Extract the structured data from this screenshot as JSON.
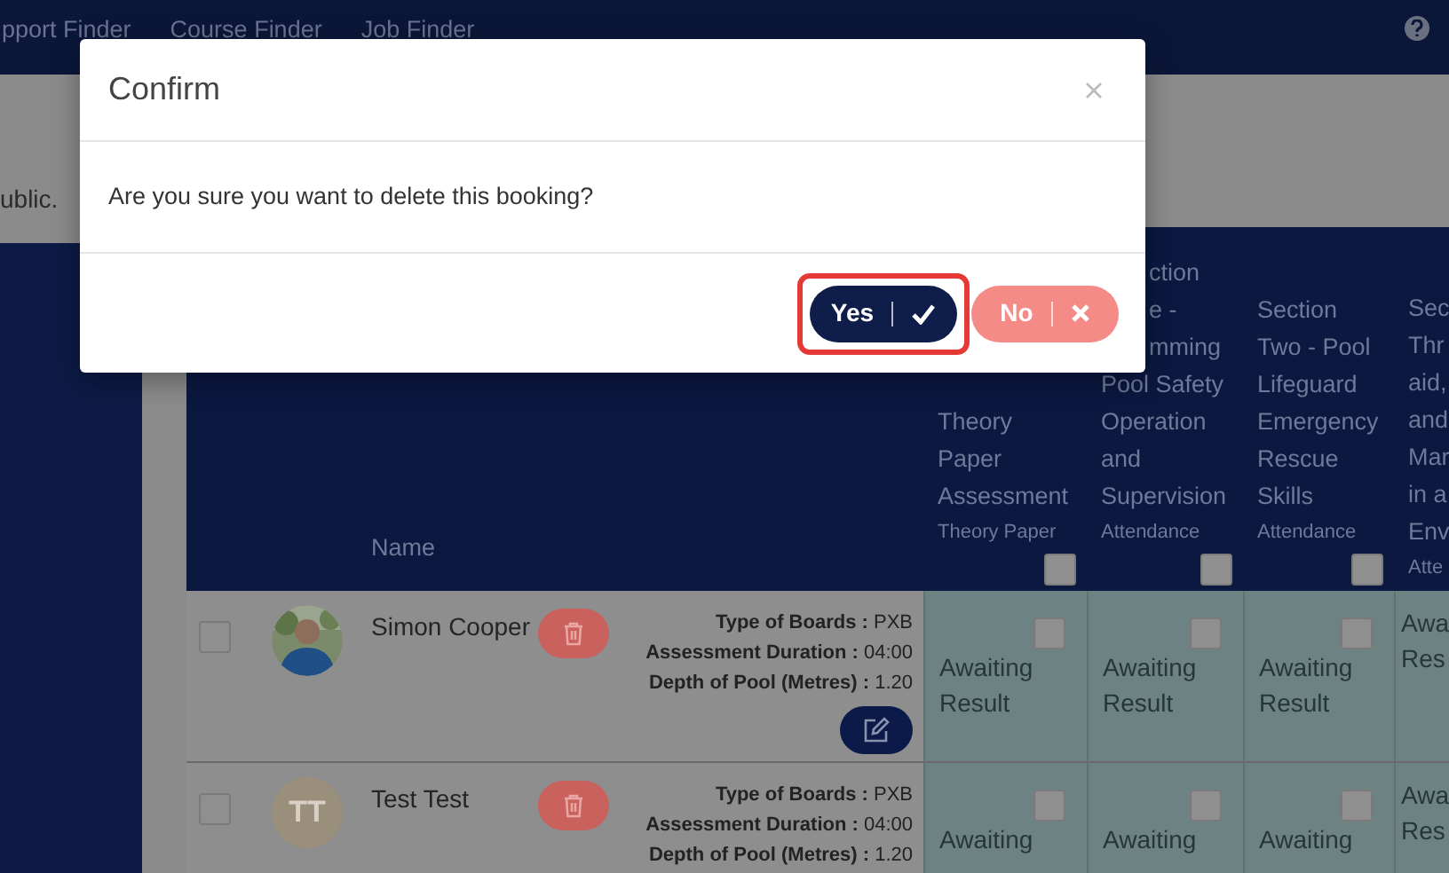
{
  "nav": {
    "links": [
      "pport Finder",
      "Course Finder",
      "Job Finder"
    ]
  },
  "notice": {
    "text": "ublic."
  },
  "table": {
    "name_header": "Name",
    "columns": [
      {
        "title_lines": [
          {
            "text": "Theory"
          },
          {
            "text": "Paper"
          },
          {
            "text": "Assessment"
          }
        ],
        "sub": "Theory Paper",
        "checkbox": true,
        "checked": false
      },
      {
        "title_lines": [
          {
            "text": "ction",
            "cut": true
          },
          {
            "text": "e -",
            "cut": true
          },
          {
            "text": "mming",
            "cut": true
          },
          {
            "text": "Pool Safety"
          },
          {
            "text": "Operation"
          },
          {
            "text": "and"
          },
          {
            "text": "Supervision"
          }
        ],
        "sub": "Attendance",
        "checkbox": true,
        "checked": false
      },
      {
        "title_lines": [
          {
            "text": "Section"
          },
          {
            "text": "Two - Pool"
          },
          {
            "text": "Lifeguard"
          },
          {
            "text": "Emergency"
          },
          {
            "text": "Rescue"
          },
          {
            "text": "Skills"
          }
        ],
        "sub": "Attendance",
        "checkbox": true,
        "checked": false
      },
      {
        "title_lines": [
          {
            "text": "Sec"
          },
          {
            "text": "Thr"
          },
          {
            "text": "aid,"
          },
          {
            "text": "and"
          },
          {
            "text": "Mar"
          },
          {
            "text": "in a"
          },
          {
            "text": "Env"
          }
        ],
        "sub": "Atte",
        "checkbox": false
      }
    ],
    "rows": [
      {
        "selected": false,
        "avatar": {
          "kind": "picture"
        },
        "name": "Simon Cooper",
        "details": [
          "**Type of Boards :** PXB",
          "**Assessment Duration :** 04:00",
          "**Depth of Pool (Metres) :** 1.20"
        ],
        "edit": true,
        "cells": [
          {
            "lines": [
              "Awaiting",
              "Result"
            ],
            "checkbox": true,
            "checked": false
          },
          {
            "lines": [
              "Awaiting",
              "Result"
            ],
            "checkbox": true,
            "checked": false
          },
          {
            "lines": [
              "Awaiting",
              "Result"
            ],
            "checkbox": true,
            "checked": false
          },
          {
            "lines": [
              "Awa",
              "Res"
            ],
            "checkbox": false
          }
        ]
      },
      {
        "selected": false,
        "avatar": {
          "kind": "initials",
          "text": "TT"
        },
        "name": "Test Test",
        "details": [
          "**Type of Boards :** PXB",
          "**Assessment Duration :** 04:00",
          "**Depth of Pool (Metres) :** 1.20"
        ],
        "edit": false,
        "cells": [
          {
            "lines": [
              "Awaiting"
            ],
            "checkbox": true,
            "checked": false
          },
          {
            "lines": [
              "Awaiting"
            ],
            "checkbox": true,
            "checked": false
          },
          {
            "lines": [
              "Awaiting"
            ],
            "checkbox": true,
            "checked": false
          },
          {
            "lines": [
              "Awa",
              "Res"
            ],
            "checkbox": false
          }
        ]
      }
    ]
  },
  "dialog": {
    "title": "Confirm",
    "message": "Are you sure you want to delete this booking?",
    "buttons": [
      {
        "kind": "yes",
        "label": "Yes",
        "highlighted": true
      },
      {
        "kind": "no",
        "label": "No",
        "highlighted": false
      }
    ]
  }
}
